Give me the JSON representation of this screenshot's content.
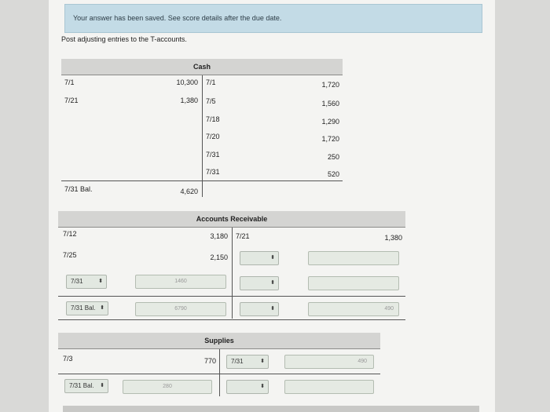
{
  "banner": {
    "text": "Your answer has been saved. See score details after the due date."
  },
  "instruction": "Post adjusting entries to the T-accounts.",
  "cash": {
    "title": "Cash",
    "debits": [
      {
        "date": "7/1",
        "amount": "10,300"
      },
      {
        "date": "7/21",
        "amount": "1,380"
      }
    ],
    "credits": [
      {
        "date": "7/1",
        "amount": "1,720"
      },
      {
        "date": "7/5",
        "amount": "1,560"
      },
      {
        "date": "7/18",
        "amount": "1,290"
      },
      {
        "date": "7/20",
        "amount": "1,720"
      },
      {
        "date": "7/31",
        "amount": "250"
      },
      {
        "date": "7/31",
        "amount": "520"
      }
    ],
    "balance_label": "7/31 Bal.",
    "balance_amount": "4,620"
  },
  "ar": {
    "title": "Accounts Receivable",
    "row1": {
      "date": "7/12",
      "amount": "3,180",
      "credit_date": "7/21",
      "credit_amount": "1,380"
    },
    "row2": {
      "date": "7/25",
      "amount": "2,150"
    },
    "row3": {
      "date_select": "7/31",
      "amount_input": "1460"
    },
    "balance": {
      "date_select": "7/31 Bal.",
      "amount_input": "6790",
      "credit_amount_input": "490"
    }
  },
  "supplies": {
    "title": "Supplies",
    "row1": {
      "date": "7/3",
      "amount": "770",
      "credit_date_select": "7/31",
      "credit_amount_input": "490"
    },
    "balance": {
      "date_select": "7/31 Bal.",
      "amount_input": "280"
    }
  },
  "icons": {
    "select_arrow": "⬍"
  }
}
